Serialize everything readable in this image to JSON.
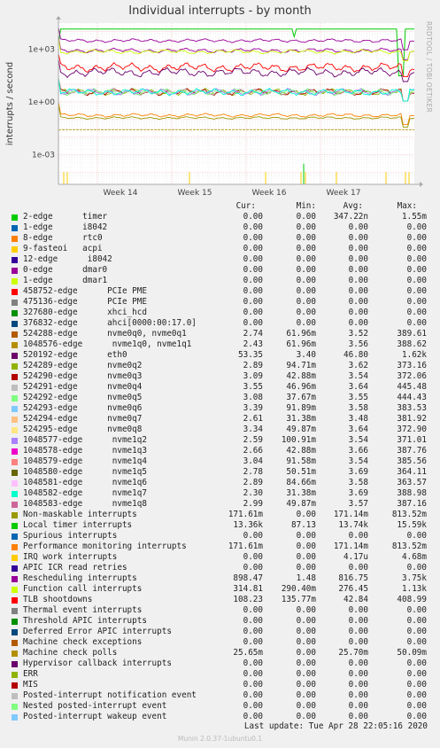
{
  "title": "Individual interrupts - by month",
  "side_credit": "RRDTOOL / TOBI OETIKER",
  "footer": {
    "last_update": "Last update: Tue Apr 28 22:05:16 2020",
    "version": "Munin 2.0.37-1ubuntu0.1"
  },
  "legend_headers": {
    "cur": "Cur:",
    "min": "Min:",
    "avg": "Avg:",
    "max": "Max:"
  },
  "chart_data": {
    "type": "line",
    "title": "Individual interrupts - by month",
    "ylabel": "interrupts / second",
    "yscale": "log",
    "yticks": [
      "1e+03",
      "1e+00",
      "1e-03"
    ],
    "xticks": [
      "Week 14",
      "Week 15",
      "Week 16",
      "Week 17"
    ],
    "ylim": [
      2e-05,
      30000
    ],
    "grid": true,
    "series": [
      {
        "name": "2-edge      timer",
        "color": "#00cc00",
        "cur": "0.00",
        "min": "0.00",
        "avg": "347.22n",
        "max": "1.55m"
      },
      {
        "name": "1-edge      i8042",
        "color": "#0066b3",
        "cur": "0.00",
        "min": "0.00",
        "avg": "0.00",
        "max": "0.00"
      },
      {
        "name": "8-edge      rtc0",
        "color": "#ff8000",
        "cur": "0.00",
        "min": "0.00",
        "avg": "0.00",
        "max": "0.00"
      },
      {
        "name": "9-fasteoi   acpi",
        "color": "#ffcc00",
        "cur": "0.00",
        "min": "0.00",
        "avg": "0.00",
        "max": "0.00"
      },
      {
        "name": "12-edge      i8042",
        "color": "#330099",
        "cur": "0.00",
        "min": "0.00",
        "avg": "0.00",
        "max": "0.00"
      },
      {
        "name": "0-edge      dmar0",
        "color": "#990099",
        "cur": "0.00",
        "min": "0.00",
        "avg": "0.00",
        "max": "0.00"
      },
      {
        "name": "1-edge      dmar1",
        "color": "#ccff00",
        "cur": "0.00",
        "min": "0.00",
        "avg": "0.00",
        "max": "0.00"
      },
      {
        "name": "458752-edge      PCIe PME",
        "color": "#ff0000",
        "cur": "0.00",
        "min": "0.00",
        "avg": "0.00",
        "max": "0.00"
      },
      {
        "name": "475136-edge      PCIe PME",
        "color": "#808080",
        "cur": "0.00",
        "min": "0.00",
        "avg": "0.00",
        "max": "0.00"
      },
      {
        "name": "327680-edge      xhci_hcd",
        "color": "#008f00",
        "cur": "0.00",
        "min": "0.00",
        "avg": "0.00",
        "max": "0.00"
      },
      {
        "name": "376832-edge      ahci[0000:00:17.0]",
        "color": "#00487d",
        "cur": "0.00",
        "min": "0.00",
        "avg": "0.00",
        "max": "0.00"
      },
      {
        "name": "524288-edge      nvme0q0, nvme0q1",
        "color": "#b35a00",
        "cur": "2.74",
        "min": "61.96m",
        "avg": "3.52",
        "max": "389.61"
      },
      {
        "name": "1048576-edge      nvme1q0, nvme1q1",
        "color": "#b38f00",
        "cur": "2.43",
        "min": "61.96m",
        "avg": "3.56",
        "max": "388.62"
      },
      {
        "name": "520192-edge      eth0",
        "color": "#6b006b",
        "cur": "53.35",
        "min": "3.40",
        "avg": "46.80",
        "max": "1.62k"
      },
      {
        "name": "524289-edge      nvme0q2",
        "color": "#8fb300",
        "cur": "2.89",
        "min": "94.71m",
        "avg": "3.62",
        "max": "373.16"
      },
      {
        "name": "524290-edge      nvme0q3",
        "color": "#b30000",
        "cur": "3.09",
        "min": "42.88m",
        "avg": "3.54",
        "max": "372.06"
      },
      {
        "name": "524291-edge      nvme0q4",
        "color": "#bebebe",
        "cur": "3.55",
        "min": "46.96m",
        "avg": "3.64",
        "max": "445.48"
      },
      {
        "name": "524292-edge      nvme0q5",
        "color": "#80ff80",
        "cur": "3.08",
        "min": "37.67m",
        "avg": "3.55",
        "max": "444.43"
      },
      {
        "name": "524293-edge      nvme0q6",
        "color": "#80c9ff",
        "cur": "3.39",
        "min": "91.89m",
        "avg": "3.58",
        "max": "383.53"
      },
      {
        "name": "524294-edge      nvme0q7",
        "color": "#ffc080",
        "cur": "2.61",
        "min": "31.38m",
        "avg": "3.48",
        "max": "381.92"
      },
      {
        "name": "524295-edge      nvme0q8",
        "color": "#ffe680",
        "cur": "3.34",
        "min": "49.87m",
        "avg": "3.64",
        "max": "372.90"
      },
      {
        "name": "1048577-edge      nvme1q2",
        "color": "#aa80ff",
        "cur": "2.59",
        "min": "100.91m",
        "avg": "3.54",
        "max": "371.01"
      },
      {
        "name": "1048578-edge      nvme1q3",
        "color": "#ee00cc",
        "cur": "2.66",
        "min": "42.88m",
        "avg": "3.66",
        "max": "387.76"
      },
      {
        "name": "1048579-edge      nvme1q4",
        "color": "#ff8080",
        "cur": "3.04",
        "min": "91.58m",
        "avg": "3.54",
        "max": "385.56"
      },
      {
        "name": "1048580-edge      nvme1q5",
        "color": "#666600",
        "cur": "2.78",
        "min": "50.51m",
        "avg": "3.69",
        "max": "364.11"
      },
      {
        "name": "1048581-edge      nvme1q6",
        "color": "#ffbfff",
        "cur": "2.89",
        "min": "84.66m",
        "avg": "3.58",
        "max": "363.57"
      },
      {
        "name": "1048582-edge      nvme1q7",
        "color": "#00ffcc",
        "cur": "2.30",
        "min": "31.38m",
        "avg": "3.69",
        "max": "388.98"
      },
      {
        "name": "1048583-edge      nvme1q8",
        "color": "#cc6699",
        "cur": "2.99",
        "min": "49.87m",
        "avg": "3.57",
        "max": "387.16"
      },
      {
        "name": "Non-maskable interrupts",
        "color": "#999900",
        "cur": "171.61m",
        "min": "0.00",
        "avg": "171.14m",
        "max": "813.52m"
      },
      {
        "name": "Local timer interrupts",
        "color": "#00cc00",
        "cur": "13.36k",
        "min": "87.13",
        "avg": "13.74k",
        "max": "15.59k"
      },
      {
        "name": "Spurious interrupts",
        "color": "#0066b3",
        "cur": "0.00",
        "min": "0.00",
        "avg": "0.00",
        "max": "0.00"
      },
      {
        "name": "Performance monitoring interrupts",
        "color": "#ff8000",
        "cur": "171.61m",
        "min": "0.00",
        "avg": "171.14m",
        "max": "813.52m"
      },
      {
        "name": "IRQ work interrupts",
        "color": "#ffcc00",
        "cur": "0.00",
        "min": "0.00",
        "avg": "4.17u",
        "max": "4.68m"
      },
      {
        "name": "APIC ICR read retries",
        "color": "#330099",
        "cur": "0.00",
        "min": "0.00",
        "avg": "0.00",
        "max": "0.00"
      },
      {
        "name": "Rescheduling interrupts",
        "color": "#990099",
        "cur": "898.47",
        "min": "1.48",
        "avg": "816.75",
        "max": "3.75k"
      },
      {
        "name": "Function call interrupts",
        "color": "#ccff00",
        "cur": "314.81",
        "min": "290.40m",
        "avg": "276.45",
        "max": "1.13k"
      },
      {
        "name": "TLB shootdowns",
        "color": "#ff0000",
        "cur": "108.23",
        "min": "135.77m",
        "avg": "42.84",
        "max": "408.99"
      },
      {
        "name": "Thermal event interrupts",
        "color": "#808080",
        "cur": "0.00",
        "min": "0.00",
        "avg": "0.00",
        "max": "0.00"
      },
      {
        "name": "Threshold APIC interrupts",
        "color": "#008f00",
        "cur": "0.00",
        "min": "0.00",
        "avg": "0.00",
        "max": "0.00"
      },
      {
        "name": "Deferred Error APIC interrupts",
        "color": "#00487d",
        "cur": "0.00",
        "min": "0.00",
        "avg": "0.00",
        "max": "0.00"
      },
      {
        "name": "Machine check exceptions",
        "color": "#b35a00",
        "cur": "0.00",
        "min": "0.00",
        "avg": "0.00",
        "max": "0.00"
      },
      {
        "name": "Machine check polls",
        "color": "#b38f00",
        "cur": "25.65m",
        "min": "0.00",
        "avg": "25.70m",
        "max": "50.09m"
      },
      {
        "name": "Hypervisor callback interrupts",
        "color": "#6b006b",
        "cur": "0.00",
        "min": "0.00",
        "avg": "0.00",
        "max": "0.00"
      },
      {
        "name": "ERR",
        "color": "#8fb300",
        "cur": "0.00",
        "min": "0.00",
        "avg": "0.00",
        "max": "0.00"
      },
      {
        "name": "MIS",
        "color": "#b30000",
        "cur": "0.00",
        "min": "0.00",
        "avg": "0.00",
        "max": "0.00"
      },
      {
        "name": "Posted-interrupt notification event",
        "color": "#bebebe",
        "cur": "0.00",
        "min": "0.00",
        "avg": "0.00",
        "max": "0.00"
      },
      {
        "name": "Nested posted-interrupt event",
        "color": "#80ff80",
        "cur": "0.00",
        "min": "0.00",
        "avg": "0.00",
        "max": "0.00"
      },
      {
        "name": "Posted-interrupt wakeup event",
        "color": "#80c9ff",
        "cur": "0.00",
        "min": "0.00",
        "avg": "0.00",
        "max": "0.00"
      }
    ]
  }
}
